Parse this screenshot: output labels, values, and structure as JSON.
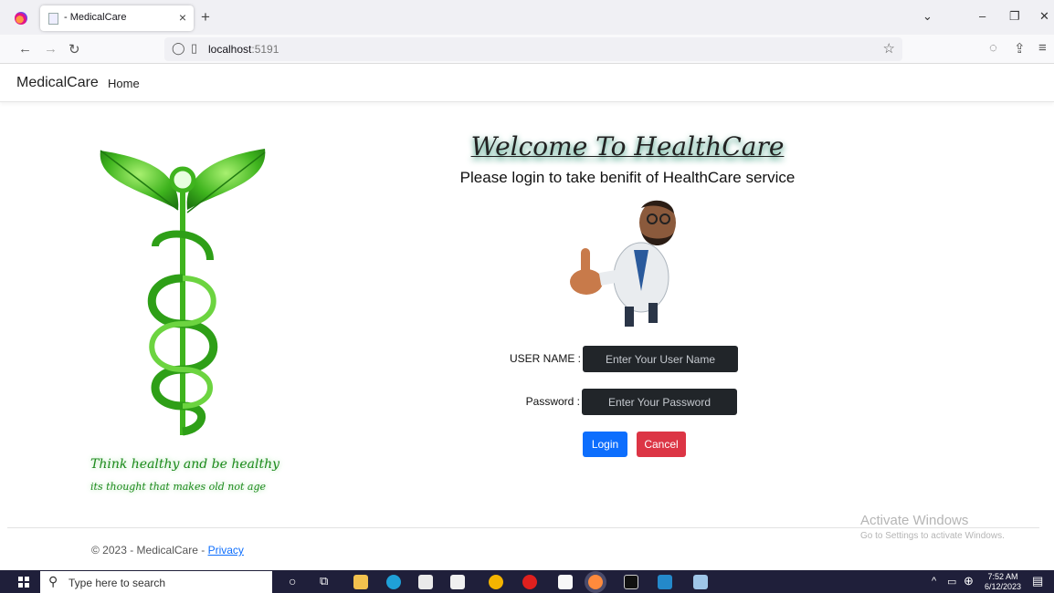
{
  "browser": {
    "tab_title": "- MedicalCare",
    "url_host": "localhost",
    "url_port": ":5191"
  },
  "site": {
    "brand": "MedicalCare",
    "nav_home": "Home"
  },
  "left_panel": {
    "slogan_main": "Think healthy and be healthy",
    "slogan_sub": "its thought that makes old not age"
  },
  "login": {
    "welcome": "Welcome To HealthCare",
    "subtitle": "Please login to take benifit of HealthCare service",
    "username_label": "USER NAME :",
    "username_placeholder": "Enter Your User Name",
    "password_label": "Password :",
    "password_placeholder": "Enter Your Password",
    "login_button": "Login",
    "cancel_button": "Cancel"
  },
  "footer": {
    "copyright": "© 2023 - MedicalCare - ",
    "privacy_link": "Privacy"
  },
  "watermark": {
    "line1": "Activate Windows",
    "line2": "Go to Settings to activate Windows."
  },
  "taskbar": {
    "search_placeholder": "Type here to search",
    "time": "7:52 AM",
    "date": "6/12/2023"
  },
  "colors": {
    "login_blue": "#0d6efd",
    "cancel_red": "#dc3545",
    "input_dark": "#212529",
    "slogan_green": "#1b8a1b"
  }
}
